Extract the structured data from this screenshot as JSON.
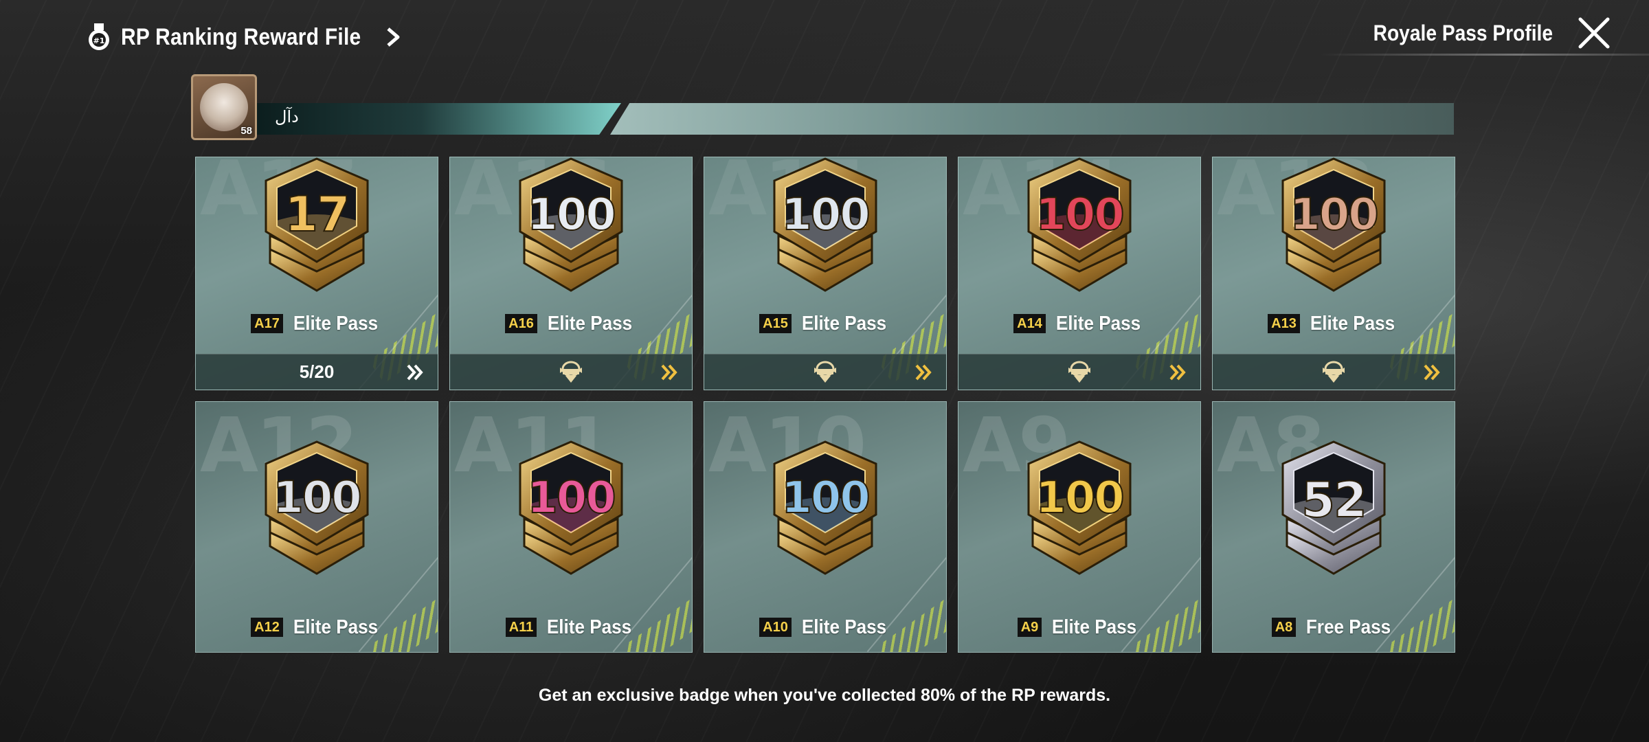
{
  "header": {
    "title": "RP Ranking Reward File",
    "profile_label": "Royale Pass Profile"
  },
  "player": {
    "name": "دآل",
    "level": "58"
  },
  "cards": [
    {
      "watermark": "A17",
      "season": "A17",
      "pass": "Elite Pass",
      "rank": "17",
      "footer": "5/20",
      "footer_type": "text",
      "num_color": "#f0c060"
    },
    {
      "watermark": "A16",
      "season": "A16",
      "pass": "Elite Pass",
      "rank": "100",
      "footer": "",
      "footer_type": "icon",
      "num_color": "#e8ecf2"
    },
    {
      "watermark": "A15",
      "season": "A15",
      "pass": "Elite Pass",
      "rank": "100",
      "footer": "",
      "footer_type": "icon",
      "num_color": "#dfe6ee"
    },
    {
      "watermark": "A14",
      "season": "A14",
      "pass": "Elite Pass",
      "rank": "100",
      "footer": "",
      "footer_type": "icon",
      "num_color": "#e2465a"
    },
    {
      "watermark": "A13",
      "season": "A13",
      "pass": "Elite Pass",
      "rank": "100",
      "footer": "",
      "footer_type": "icon",
      "num_color": "#d9a48a"
    },
    {
      "watermark": "A12",
      "season": "A12",
      "pass": "Elite Pass",
      "rank": "100",
      "footer": null,
      "num_color": "#dfe2e8"
    },
    {
      "watermark": "A11",
      "season": "A11",
      "pass": "Elite Pass",
      "rank": "100",
      "footer": null,
      "num_color": "#e85a98"
    },
    {
      "watermark": "A10",
      "season": "A10",
      "pass": "Elite Pass",
      "rank": "100",
      "footer": null,
      "num_color": "#8fc4ea"
    },
    {
      "watermark": "A9",
      "season": "A9",
      "pass": "Elite Pass",
      "rank": "100",
      "footer": null,
      "num_color": "#f2c84a"
    },
    {
      "watermark": "A8",
      "season": "A8",
      "pass": "Free Pass",
      "rank": "52",
      "footer": null,
      "num_color": "#e8e8ee",
      "silver": true
    }
  ],
  "bottom_note": "Get an exclusive badge when you've collected 80% of the RP rewards.",
  "colors": {
    "accent_gold": "#f5d04a",
    "card_teal": "#7c9996",
    "badge_gold": "#c9a35a",
    "badge_silver": "#a8a8b4"
  }
}
